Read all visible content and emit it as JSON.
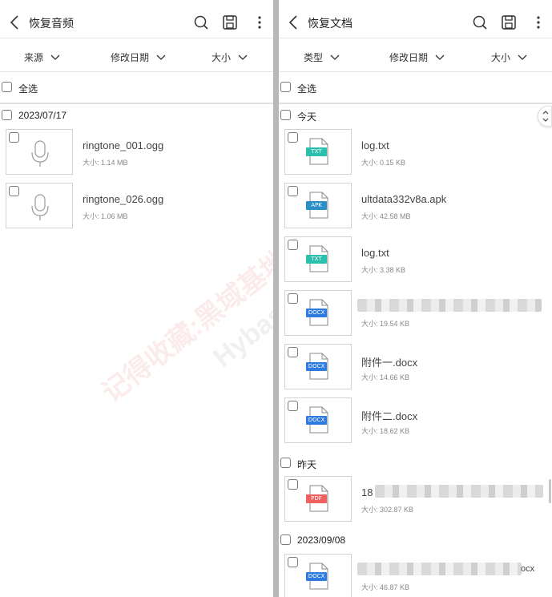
{
  "left": {
    "title": "恢复音频",
    "filters": [
      "来源",
      "修改日期",
      "大小"
    ],
    "select_all": "全选",
    "groups": [
      {
        "date": "2023/07/17",
        "items": [
          {
            "name": "ringtone_001.ogg",
            "size": "大小: 1.14 MB"
          },
          {
            "name": "ringtone_026.ogg",
            "size": "大小: 1.06 MB"
          }
        ]
      }
    ]
  },
  "right": {
    "title": "恢复文档",
    "filters": [
      "类型",
      "修改日期",
      "大小"
    ],
    "select_all": "全选",
    "groups": [
      {
        "date": "今天",
        "items": [
          {
            "name": "log.txt",
            "size": "大小: 0.15 KB",
            "type": "TXT"
          },
          {
            "name": "ultdata332v8a.apk",
            "size": "大小: 42.58 MB",
            "type": "APK"
          },
          {
            "name": "log.txt",
            "size": "大小: 3.38 KB",
            "type": "TXT"
          },
          {
            "name": "",
            "size": "大小: 19.54 KB",
            "type": "DOCX"
          },
          {
            "name": "附件一.docx",
            "size": "大小: 14.66 KB",
            "type": "DOCX"
          },
          {
            "name": "附件二.docx",
            "size": "大小: 18.62 KB",
            "type": "DOCX"
          }
        ]
      },
      {
        "date": "昨天",
        "items": [
          {
            "name": "18",
            "size": "大小: 302.87 KB",
            "type": "PDF"
          }
        ]
      },
      {
        "date": "2023/09/08",
        "items": [
          {
            "name": "ocx",
            "size": "大小: 46.87 KB",
            "type": "DOCX"
          }
        ]
      }
    ]
  },
  "watermark": {
    "cn": "记得收藏:黑域基地",
    "en": "Hybase.com"
  },
  "colors": {
    "txt": "#2bbfae",
    "apk": "#2a8fc6",
    "docx": "#2f7be0",
    "pdf": "#f0605e"
  },
  "icons": {
    "back": "chevron-left-icon",
    "search": "search-icon",
    "save": "save-icon",
    "more": "more-vertical-icon"
  }
}
